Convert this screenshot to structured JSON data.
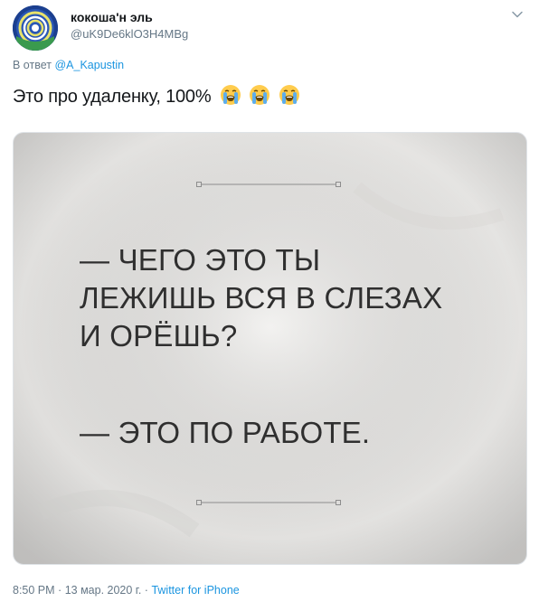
{
  "author": {
    "name": "кокоша'н эль",
    "handle": "@uK9De6klO3H4MBg"
  },
  "reply": {
    "prefix": "В ответ",
    "to": "@A_Kapustin"
  },
  "tweet": {
    "text": "Это про удаленку, 100%",
    "emoji": [
      "loudly-crying-face",
      "loudly-crying-face",
      "loudly-crying-face"
    ]
  },
  "image": {
    "lines_question": [
      "— ЧЕГО ЭТО ТЫ",
      "ЛЕЖИШЬ ВСЯ В СЛЕЗАХ",
      "И ОРЁШЬ?"
    ],
    "line_answer": "— ЭТО ПО РАБОТЕ."
  },
  "footer": {
    "time": "8:50 PM",
    "date": "13 мар. 2020 г.",
    "source": "Twitter for iPhone",
    "sep": "·"
  },
  "icons": {
    "menu": "chevron-down-icon"
  },
  "colors": {
    "link": "#1b95e0",
    "secondary": "#657786",
    "text": "#14171a"
  }
}
